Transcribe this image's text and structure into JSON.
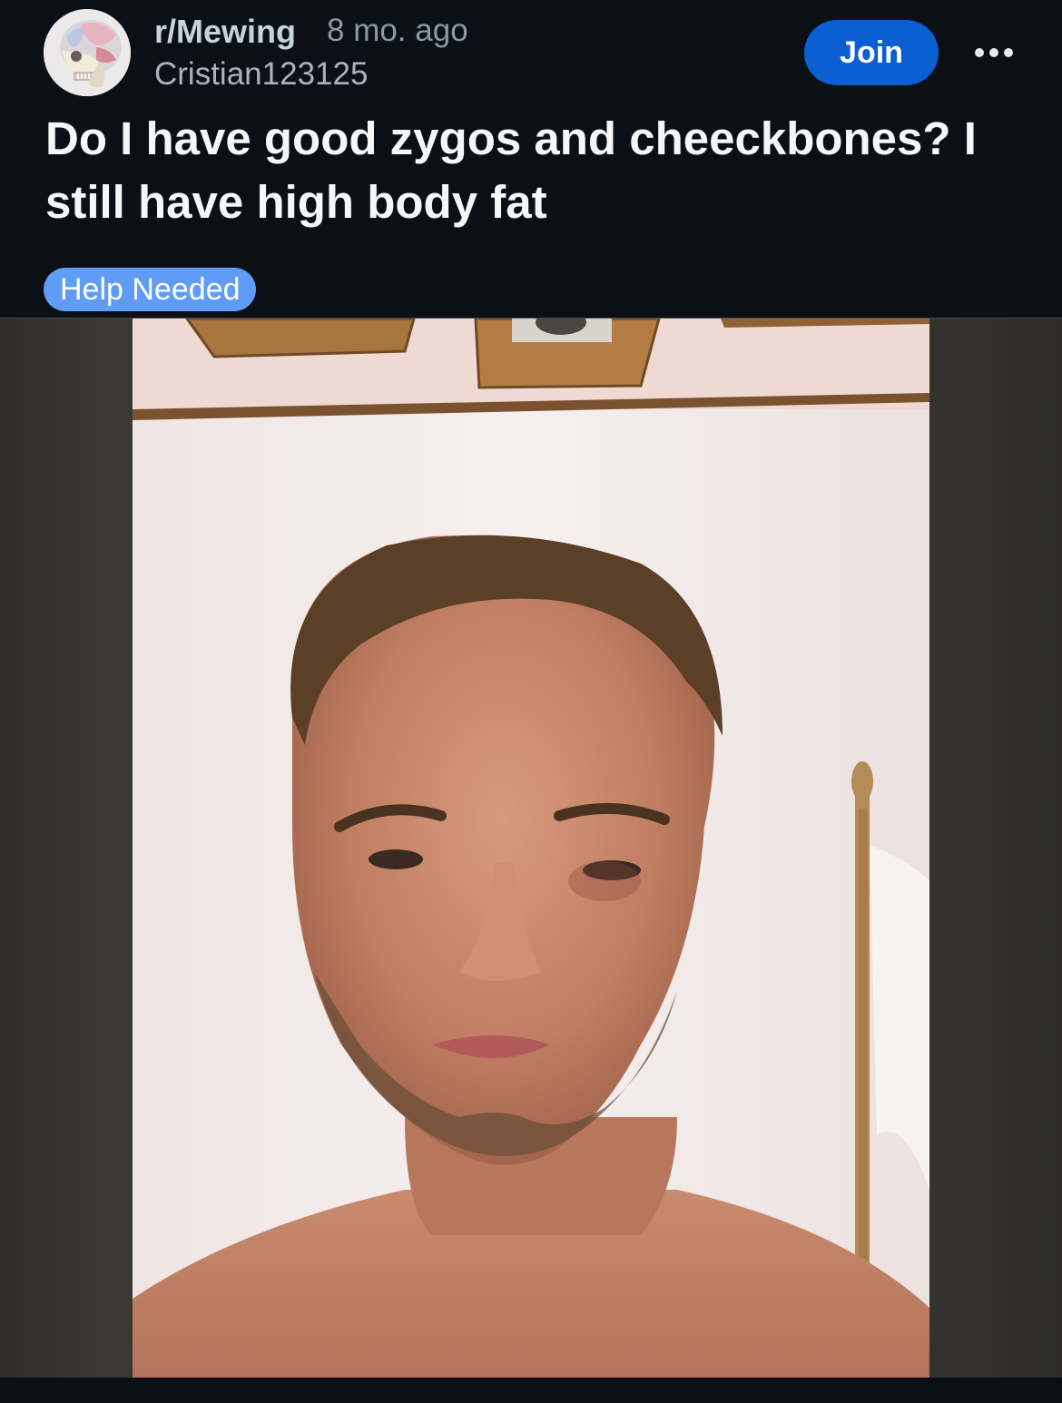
{
  "post": {
    "subreddit": "r/Mewing",
    "time": "8 mo. ago",
    "author": "Cristian123125",
    "join_label": "Join",
    "title": "Do I have good zygos and cheeckbones? I still have high body fat",
    "flair": "Help Needed"
  },
  "icons": {
    "avatar": "skull-anatomy-avatar-icon",
    "more": "more-options-icon"
  },
  "colors": {
    "background": "#0b1016",
    "join_button": "#0a5fd3",
    "flair": "#5e9cf6"
  }
}
